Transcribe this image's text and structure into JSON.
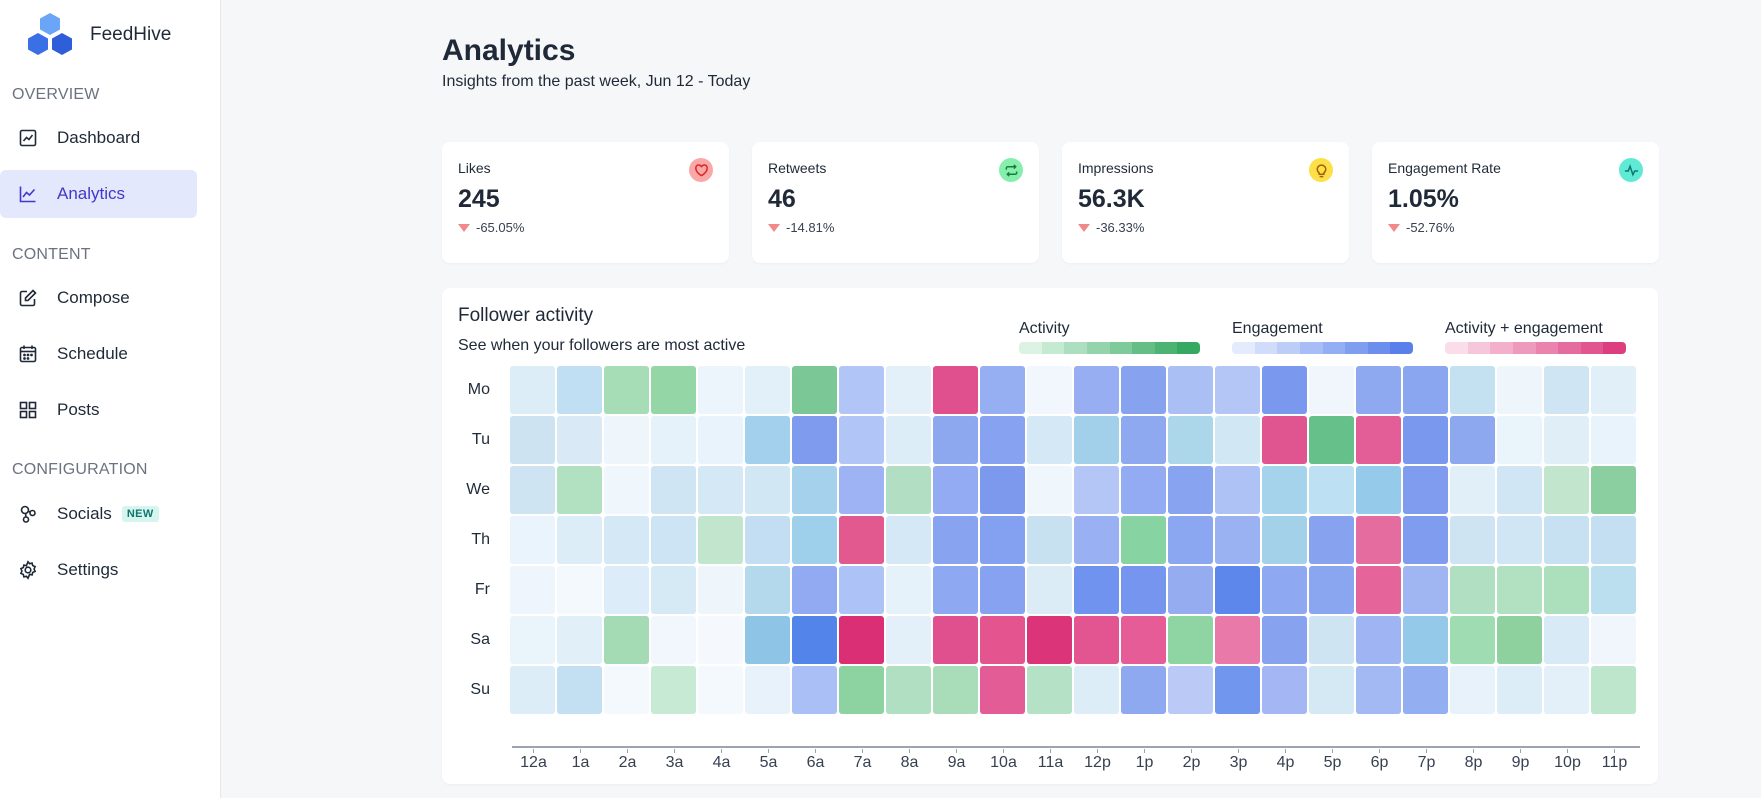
{
  "app": {
    "name": "FeedHive"
  },
  "sidebar": {
    "sections": {
      "overview": "OVERVIEW",
      "content": "CONTENT",
      "configuration": "CONFIGURATION"
    },
    "items": {
      "dashboard": "Dashboard",
      "analytics": "Analytics",
      "compose": "Compose",
      "schedule": "Schedule",
      "posts": "Posts",
      "socials": "Socials",
      "socials_badge": "NEW",
      "settings": "Settings"
    },
    "active": "Analytics"
  },
  "header": {
    "title": "Analytics",
    "subtitle": "Insights from the past week, Jun 12 - Today"
  },
  "stats": [
    {
      "label": "Likes",
      "value": "245",
      "change": "-65.05%",
      "icon": "heart-icon",
      "icon_bg": "#f9a8a8",
      "icon_color": "#dc2626"
    },
    {
      "label": "Retweets",
      "value": "46",
      "change": "-14.81%",
      "icon": "retweet-icon",
      "icon_bg": "#86efac",
      "icon_color": "#15803d"
    },
    {
      "label": "Impressions",
      "value": "56.3K",
      "change": "-36.33%",
      "icon": "lightbulb-icon",
      "icon_bg": "#fde047",
      "icon_color": "#a16207"
    },
    {
      "label": "Engagement Rate",
      "value": "1.05%",
      "change": "-52.76%",
      "icon": "pulse-icon",
      "icon_bg": "#5eead4",
      "icon_color": "#0f766e"
    }
  ],
  "follower_activity": {
    "title": "Follower activity",
    "subtitle": "See when your followers are most active",
    "legend": [
      {
        "label": "Activity",
        "colors": [
          "#dcf3e4",
          "#c4ead2",
          "#acdfbf",
          "#94d4ac",
          "#7dca9a",
          "#64be86",
          "#4cb373",
          "#35a961"
        ]
      },
      {
        "label": "Engagement",
        "colors": [
          "#e4ebfd",
          "#d0dcfa",
          "#bccdf8",
          "#a8bdf5",
          "#94aef3",
          "#809ef0",
          "#6c8fee",
          "#587fea"
        ]
      },
      {
        "label": "Activity + engagement",
        "colors": [
          "#fbdde9",
          "#f6c7da",
          "#f2b0cb",
          "#ee9abc",
          "#ea83ad",
          "#e56c9e",
          "#e1568f",
          "#dc3f80"
        ]
      }
    ],
    "days": [
      "Mo",
      "Tu",
      "We",
      "Th",
      "Fr",
      "Sa",
      "Su"
    ],
    "hours": [
      "12a",
      "1a",
      "2a",
      "3a",
      "4a",
      "5a",
      "6a",
      "7a",
      "8a",
      "9a",
      "10a",
      "11a",
      "12p",
      "1p",
      "2p",
      "3p",
      "4p",
      "5p",
      "6p",
      "7p",
      "8p",
      "9p",
      "10p",
      "11p"
    ],
    "cells": [
      [
        "#dcedf8",
        "#c1dff2",
        "#a7ddb6",
        "#94d6a6",
        "#edf5fc",
        "#e1f0f9",
        "#7bc896",
        "#b1c5f6",
        "#e3eff9",
        "#e0508e",
        "#96aff3",
        "#f2f7fd",
        "#97aff2",
        "#87a3f0",
        "#aabff4",
        "#b3c6f6",
        "#7a98ee",
        "#f1f6fd",
        "#8fa9f1",
        "#8aa6f0",
        "#c4e1f2",
        "#eef5fb",
        "#cfe5f3",
        "#e0eff8"
      ],
      [
        "#cde3f2",
        "#d9eaf6",
        "#eef6fc",
        "#e6f2fa",
        "#e9f3fb",
        "#a3d0ec",
        "#7f9bee",
        "#b1c5f6",
        "#dcedf7",
        "#8ea8f0",
        "#86a2f0",
        "#d4e8f5",
        "#a2d0ea",
        "#8fa9f1",
        "#acd7ea",
        "#d1e7f4",
        "#e05490",
        "#65c08a",
        "#e35e96",
        "#7a98ee",
        "#8ea8f0",
        "#eaf4fb",
        "#e0eef8",
        "#e9f3fb"
      ],
      [
        "#cee4f3",
        "#b2e1c2",
        "#f0f7fc",
        "#cfe5f4",
        "#d4e8f5",
        "#d1e7f4",
        "#a5d1ec",
        "#9db3f3",
        "#b2dfc3",
        "#93abf2",
        "#7c99ee",
        "#eff6fc",
        "#b3c6f6",
        "#93abf2",
        "#88a4f0",
        "#aec2f5",
        "#a6d3ec",
        "#bde0f2",
        "#95caeb",
        "#7f9cee",
        "#e1eff9",
        "#d0e6f4",
        "#c1e5cd",
        "#8bcfa0"
      ],
      [
        "#eaf4fc",
        "#dcedf8",
        "#d4e8f5",
        "#cde4f4",
        "#c1e6cd",
        "#c3def2",
        "#9fd0eb",
        "#e2598f",
        "#d5e8f5",
        "#88a4f0",
        "#84a0f0",
        "#c7e1f1",
        "#99b0f2",
        "#87d3a1",
        "#8ca7f1",
        "#9ab2f2",
        "#a3d1ea",
        "#87a3f0",
        "#e56c9e",
        "#7f9cee",
        "#cfe4f3",
        "#d0e6f4",
        "#c8e1f2",
        "#c3dff1"
      ],
      [
        "#eef5fc",
        "#f4f9fd",
        "#dcecf8",
        "#d6eaf6",
        "#eef6fc",
        "#b4d9ec",
        "#92aaf2",
        "#adc2f6",
        "#e6f2fa",
        "#8ea8f1",
        "#86a2f0",
        "#dcecf7",
        "#6f93ee",
        "#7595ee",
        "#96acf1",
        "#5e87ec",
        "#8ea8f1",
        "#8aa6f0",
        "#e5659a",
        "#a0b6f3",
        "#b1dfc1",
        "#b2e1c2",
        "#ace0bd",
        "#bcdff0"
      ],
      [
        "#eaf4fb",
        "#e1eff9",
        "#a4dbb5",
        "#f1f7fd",
        "#f5f9fd",
        "#8ec5e6",
        "#5384ea",
        "#da2f74",
        "#e3eff9",
        "#e0508e",
        "#e45590",
        "#db3479",
        "#e35590",
        "#e65c96",
        "#8fd5a4",
        "#e879a8",
        "#87a3f0",
        "#cfe4f3",
        "#9fb5f3",
        "#95c9e9",
        "#a0dcb2",
        "#8ed19f",
        "#d8eaf6",
        "#f0f6fc"
      ],
      [
        "#dcedf8",
        "#c3e0f2",
        "#f4f9fd",
        "#c6ead3",
        "#f4f9fd",
        "#e7f2fa",
        "#a9bff6",
        "#8dd3a2",
        "#b0dfc1",
        "#a9ddb9",
        "#e45c96",
        "#b5e2c6",
        "#dcedf7",
        "#8fa9f1",
        "#bac9f6",
        "#7096ee",
        "#a4b7f4",
        "#d5e9f5",
        "#a3b9f3",
        "#94aef2",
        "#e7f2fa",
        "#ddedf7",
        "#e3f0f9",
        "#bde6cc"
      ]
    ]
  }
}
